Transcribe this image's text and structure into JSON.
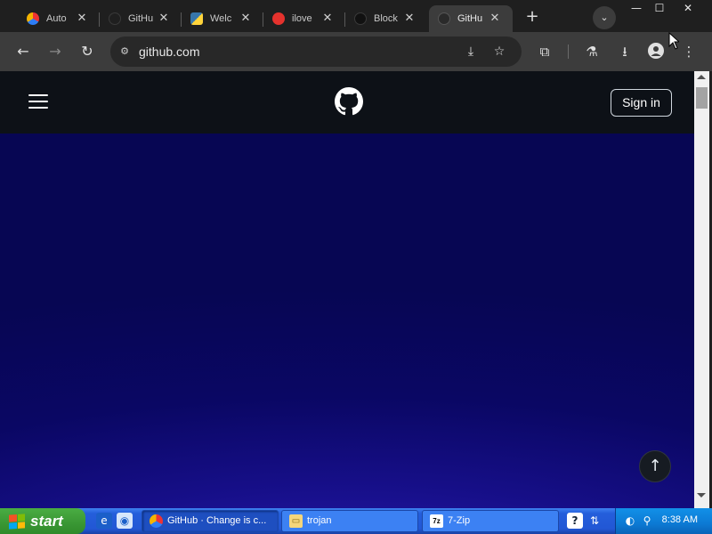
{
  "browser": {
    "tabs": [
      {
        "label": "Auto",
        "icon": "chrome-dev-icon",
        "active": false
      },
      {
        "label": "GitHu",
        "icon": "github-icon",
        "active": false
      },
      {
        "label": "Welc",
        "icon": "python-icon",
        "active": false
      },
      {
        "label": "ilove",
        "icon": "ilovepdf-icon",
        "active": false
      },
      {
        "label": "Block",
        "icon": "github-icon",
        "active": false
      },
      {
        "label": "GitHu",
        "icon": "github-icon",
        "active": true
      }
    ],
    "url": "github.com"
  },
  "page": {
    "signin_label": "Sign in"
  },
  "taskbar": {
    "start_label": "start",
    "tasks": [
      {
        "label": "GitHub · Change is c...",
        "icon": "chrome-icon",
        "active": true
      },
      {
        "label": "trojan",
        "icon": "folder-icon",
        "active": false
      },
      {
        "label": "7-Zip",
        "icon": "7zip-icon",
        "active": false
      }
    ],
    "clock": "8:38 AM"
  },
  "colors": {
    "github_header": "#0d1117",
    "hero_top": "#070653",
    "hero_glow": "#2b1db8",
    "xp_taskbar": "#245edb",
    "xp_start": "#3c9a36"
  }
}
